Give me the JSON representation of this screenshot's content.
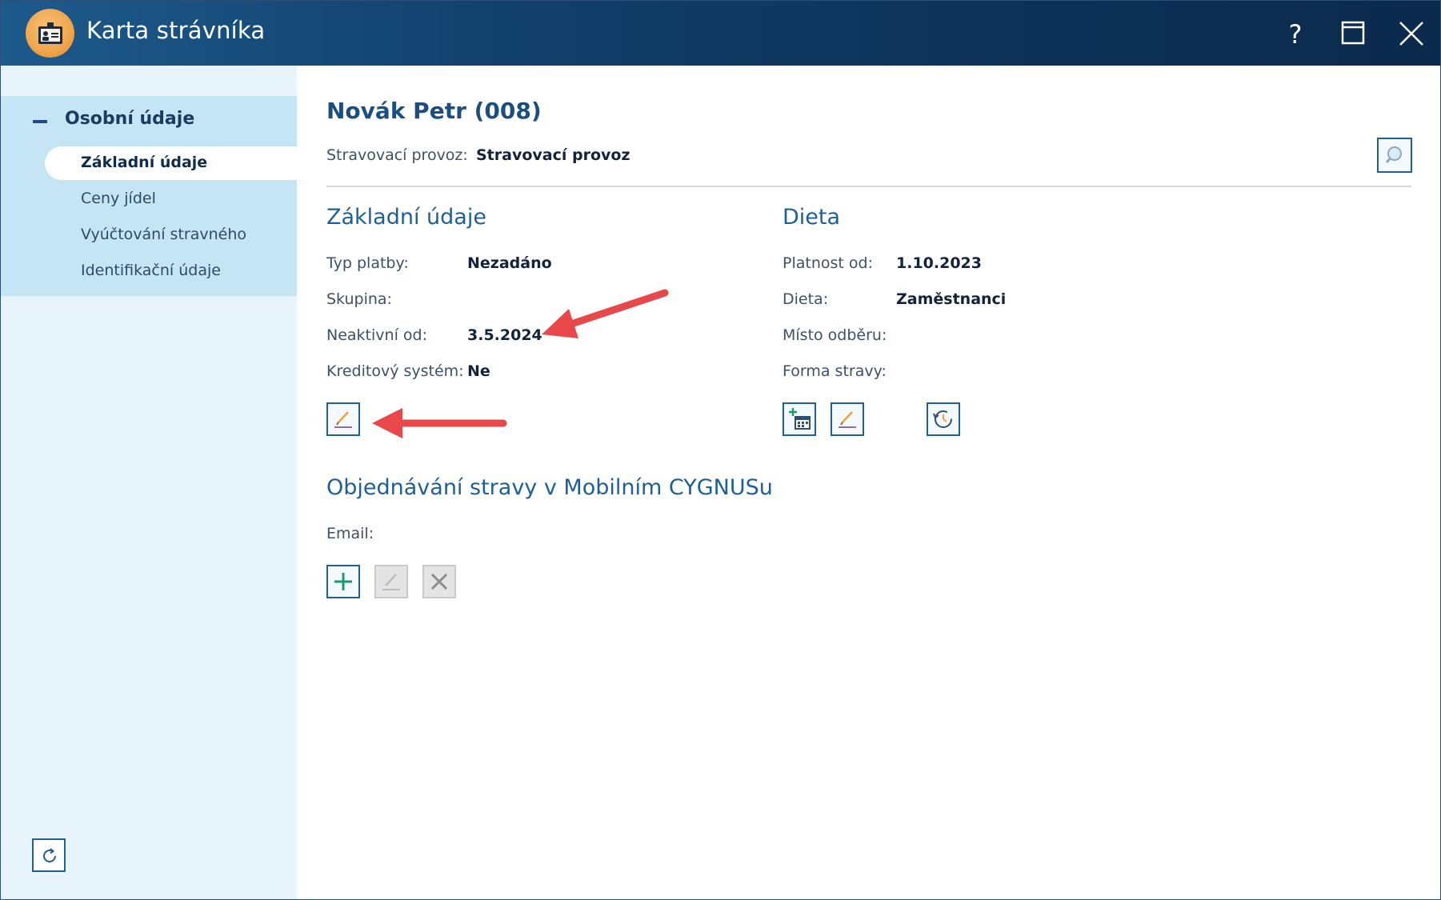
{
  "window": {
    "title": "Karta strávníka"
  },
  "sidebar": {
    "group_label": "Osobní údaje",
    "items": [
      {
        "label": "Základní údaje",
        "active": true
      },
      {
        "label": "Ceny jídel",
        "active": false
      },
      {
        "label": "Vyúčtování stravného",
        "active": false
      },
      {
        "label": "Identifikační údaje",
        "active": false
      }
    ]
  },
  "header": {
    "person": "Novák Petr (008)",
    "provoz_label": "Stravovací provoz:",
    "provoz_value": "Stravovací provoz"
  },
  "basic": {
    "title": "Základní údaje",
    "rows": [
      {
        "label": "Typ platby:",
        "value": "Nezadáno"
      },
      {
        "label": "Skupina:",
        "value": ""
      },
      {
        "label": "Neaktivní od:",
        "value": "3.5.2024"
      },
      {
        "label": "Kreditový systém:",
        "value": "Ne"
      }
    ]
  },
  "diet": {
    "title": "Dieta",
    "rows": [
      {
        "label": "Platnost od:",
        "value": "1.10.2023"
      },
      {
        "label": "Dieta:",
        "value": "Zaměstnanci"
      },
      {
        "label": "Místo odběru:",
        "value": ""
      },
      {
        "label": "Forma stravy:",
        "value": ""
      }
    ]
  },
  "mobile": {
    "title": "Objednávání stravy v Mobilním CYGNUSu",
    "email_label": "Email:",
    "email_value": ""
  },
  "colors": {
    "titlebar": "#0d3157",
    "accent": "#1f5f99",
    "sidebar_bg": "#e8f4fb",
    "sidebar_group": "#c6e5f4",
    "annotation_arrow": "#e8484a",
    "add_green": "#1a9a6a"
  },
  "icons": {
    "app": "id-card-icon",
    "help": "question-icon",
    "maximize": "maximize-icon",
    "close": "close-icon",
    "search": "search-icon",
    "edit": "pencil-icon",
    "add_diet": "calendar-add-icon",
    "history": "history-icon",
    "add": "plus-icon",
    "delete": "x-icon",
    "refresh": "refresh-icon"
  }
}
